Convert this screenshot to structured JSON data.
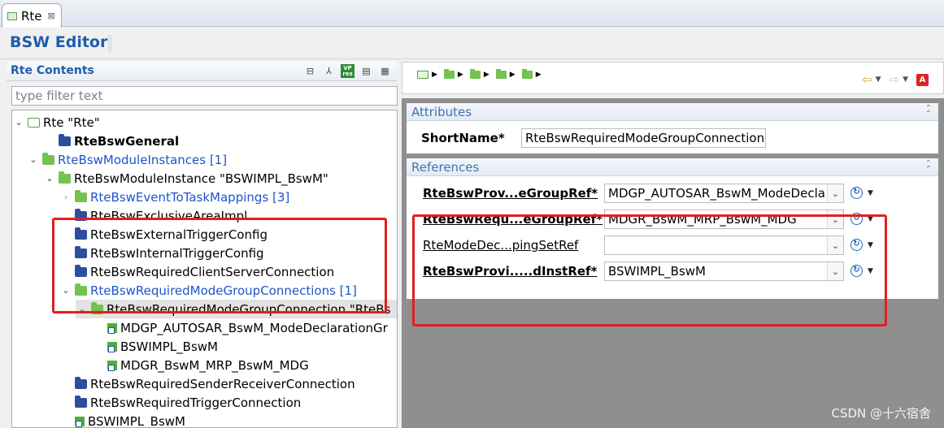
{
  "tab": {
    "label": "Rte",
    "close": "⊠"
  },
  "editor": {
    "title": "BSW Editor"
  },
  "left": {
    "title": "Rte Contents",
    "filter_placeholder": "type filter text",
    "toolbar_vp": "VP res"
  },
  "tree": [
    {
      "label": "Rte \"Rte\"",
      "style": "normal",
      "icon": "root-icon",
      "twisty": "expanded"
    },
    {
      "label": "RteBswGeneral",
      "style": "bold",
      "icon": "navy-folder-icon",
      "twisty": ""
    },
    {
      "label": "RteBswModuleInstances [1]",
      "style": "blue",
      "icon": "green-folder-icon",
      "twisty": "expanded"
    },
    {
      "label": "RteBswModuleInstance \"BSWIMPL_BswM\"",
      "style": "normal",
      "icon": "green-folder-icon",
      "twisty": "expanded"
    },
    {
      "label": "RteBswEventToTaskMappings [3]",
      "style": "blue",
      "icon": "green-folder-icon",
      "twisty": "collapsed"
    },
    {
      "label": "RteBswExclusiveAreaImpl",
      "style": "normal",
      "icon": "navy-folder-icon",
      "twisty": ""
    },
    {
      "label": "RteBswExternalTriggerConfig",
      "style": "normal",
      "icon": "navy-folder-icon",
      "twisty": ""
    },
    {
      "label": "RteBswInternalTriggerConfig",
      "style": "normal",
      "icon": "navy-folder-icon",
      "twisty": ""
    },
    {
      "label": "RteBswRequiredClientServerConnection",
      "style": "normal",
      "icon": "navy-folder-icon",
      "twisty": ""
    },
    {
      "label": "RteBswRequiredModeGroupConnections [1]",
      "style": "blue",
      "icon": "green-folder-icon",
      "twisty": "expanded"
    },
    {
      "label": "RteBswRequiredModeGroupConnection \"RteBs",
      "style": "normal",
      "icon": "green-folder-icon",
      "twisty": "expanded"
    },
    {
      "label": "MDGP_AUTOSAR_BswM_ModeDeclarationGr",
      "style": "normal",
      "icon": "reference-icon",
      "twisty": ""
    },
    {
      "label": "BSWIMPL_BswM",
      "style": "normal",
      "icon": "reference-icon",
      "twisty": ""
    },
    {
      "label": "MDGR_BswM_MRP_BswM_MDG",
      "style": "normal",
      "icon": "reference-icon",
      "twisty": ""
    },
    {
      "label": "RteBswRequiredSenderReceiverConnection",
      "style": "normal",
      "icon": "navy-folder-icon",
      "twisty": ""
    },
    {
      "label": "RteBswRequiredTriggerConnection",
      "style": "normal",
      "icon": "navy-folder-icon",
      "twisty": ""
    },
    {
      "label": "BSWIMPL_BswM",
      "style": "normal",
      "icon": "reference-icon",
      "twisty": ""
    }
  ],
  "attributes": {
    "heading": "Attributes",
    "shortname_label": "ShortName*",
    "shortname_value": "RteBswRequiredModeGroupConnection"
  },
  "references": {
    "heading": "References",
    "rows": [
      {
        "label": "RteBswProv...eGroupRef*",
        "value": "MDGP_AUTOSAR_BswM_ModeDecla",
        "bold": true
      },
      {
        "label": "RteBswRequ...eGroupRef*",
        "value": "MDGR_BswM_MRP_BswM_MDG",
        "bold": true
      },
      {
        "label": "RteModeDec...pingSetRef",
        "value": "",
        "bold": false
      },
      {
        "label": "RteBswProvi.....dInstRef*",
        "value": "BSWIMPL_BswM",
        "bold": true
      }
    ]
  },
  "watermark": "CSDN @十六宿舍",
  "colors": {
    "accent": "#1f5da8",
    "link": "#1d55c9",
    "highlight": "#e02020",
    "content_bg": "#8f8f8f"
  }
}
